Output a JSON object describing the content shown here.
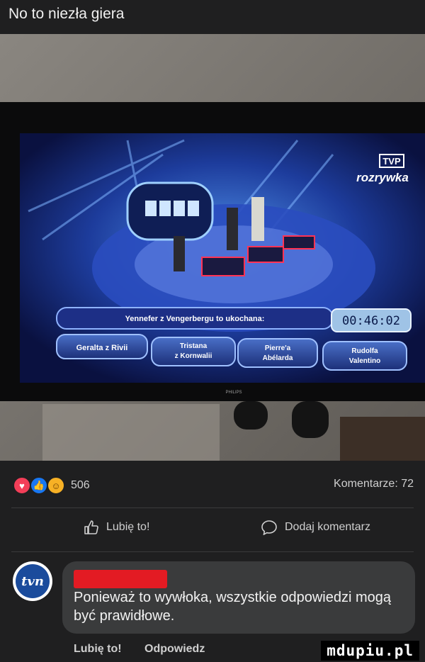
{
  "post": {
    "title": "No to niezła giera"
  },
  "tv_screen": {
    "channel_logo_top": "TVP",
    "channel_logo_bottom": "rozrywka",
    "question": "Yennefer z Vengerbergu to ukochana:",
    "timer": "00:46:02",
    "answer_a": "Geralta z Rivii",
    "answer_b_line1": "Tristana",
    "answer_b_line2": "z Kornwalii",
    "answer_c_line1": "Pierre'a",
    "answer_c_line2": "Abélarda",
    "answer_d_line1": "Rudolfa",
    "answer_d_line2": "Valentino",
    "brand": "PHILIPS"
  },
  "reactions": {
    "icons": [
      "love-icon",
      "like-icon",
      "haha-icon"
    ],
    "count": "506",
    "comments": "Komentarze: 72"
  },
  "actions": {
    "like_label": "Lubię to!",
    "comment_label": "Dodaj komentarz"
  },
  "comment": {
    "avatar_text": "tvn",
    "text": "Ponieważ to wywłoka, wszystkie odpowiedzi mogą być prawidłowe.",
    "like_label": "Lubię to!",
    "reply_label": "Odpowiedz"
  },
  "watermark": "mdupiu.pl",
  "colors": {
    "background": "#1f1f20",
    "bubble": "#3a3b3c",
    "redaction": "#e31b23",
    "like_blue": "#1877f2"
  }
}
